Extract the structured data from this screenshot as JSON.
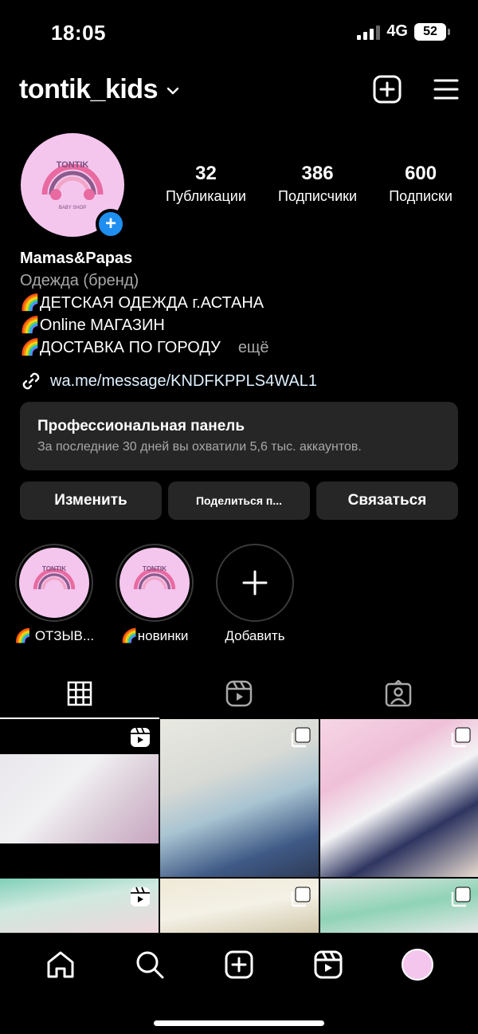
{
  "status_bar": {
    "time": "18:05",
    "network": "4G",
    "battery": "52"
  },
  "header": {
    "username": "tontik_kids"
  },
  "profile": {
    "stats": [
      {
        "value": "32",
        "label": "Публикации"
      },
      {
        "value": "386",
        "label": "Подписчики"
      },
      {
        "value": "600",
        "label": "Подписки"
      }
    ],
    "bio": {
      "name": "Mamas&Papas",
      "category": "Одежда (бренд)",
      "line1": "🌈ДЕТСКАЯ ОДЕЖДА г.АСТАНА",
      "line2": "🌈Online МАГАЗИН",
      "line3": "🌈ДОСТАВКА ПО ГОРОДУ",
      "more": "ещё"
    },
    "link": "wa.me/message/KNDFKPPLS4WAL1",
    "avatar_text": {
      "top": "TONTIK",
      "bottom": "BABY SHOP"
    }
  },
  "pro_panel": {
    "title": "Профессиональная панель",
    "subtitle": "За последние 30 дней вы охватили 5,6 тыс. аккаунтов."
  },
  "actions": {
    "edit": "Изменить",
    "share": "Поделиться п...",
    "contact": "Связаться"
  },
  "highlights": [
    {
      "label": "🌈 ОТЗЫВ..."
    },
    {
      "label": "🌈новинки"
    },
    {
      "label": "Добавить"
    }
  ],
  "colors": {
    "accent": "#1f8ef1",
    "avatar_bg": "#f4c6ee",
    "panel_bg": "#262626"
  }
}
